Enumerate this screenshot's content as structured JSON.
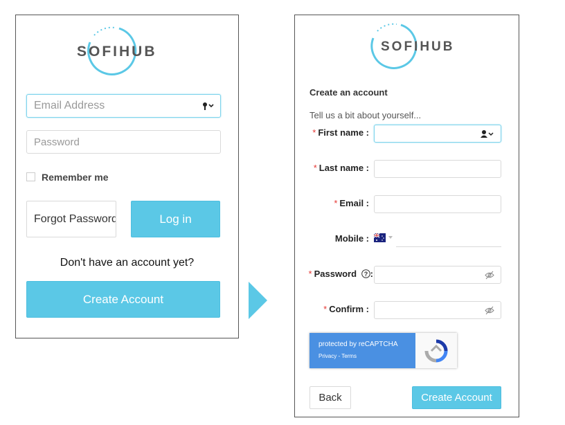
{
  "brand": {
    "name": "SOFIHUB"
  },
  "login": {
    "email_placeholder": "Email Address",
    "password_placeholder": "Password",
    "remember_label": "Remember me",
    "remember_checked": false,
    "forgot_label": "Forgot Password",
    "login_label": "Log in",
    "no_account_text": "Don't have an account yet?",
    "create_account_label": "Create Account"
  },
  "signup": {
    "heading": "Create an account",
    "subheading": "Tell us a bit about yourself...",
    "required_mark": "*",
    "fields": {
      "first_name": "First name :",
      "last_name": "Last name :",
      "email": "Email :",
      "mobile": "Mobile :",
      "password": "Password",
      "password_colon": ":",
      "confirm": "Confirm :"
    },
    "recaptcha": {
      "title": "protected by reCAPTCHA",
      "links": "Privacy - Terms"
    },
    "back_label": "Back",
    "create_account_label": "Create Account"
  },
  "colors": {
    "accent": "#5bc8e6",
    "required": "#e53935",
    "recaptcha_blue": "#4a90e2"
  },
  "icons": [
    "key-icon",
    "contact-card-icon",
    "help-circle-icon",
    "eye-off-icon",
    "australia-flag-icon",
    "recaptcha-logo-icon",
    "next-arrow"
  ]
}
